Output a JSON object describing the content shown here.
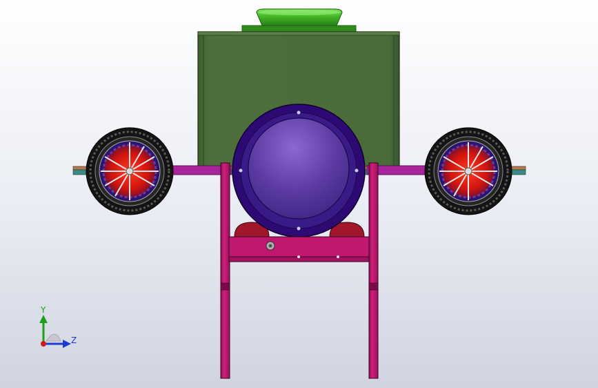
{
  "view": {
    "background_top": "#ffffff",
    "background_bottom": "#cfd4e0"
  },
  "model": {
    "hopper_color": "#4a6b3a",
    "hopper_lid_color": "#3fb324",
    "drum_ring_color": "#2d0a73",
    "drum_color": "#5a3aa0",
    "frame_color": "#c0176f",
    "axle_color": "#8a2aa0",
    "tire_color": "#1a1a1a",
    "wheel_hub_color": "#e01a14"
  },
  "triad": {
    "y_label": "Y",
    "z_label": "Z",
    "y_color": "#1aa01a",
    "z_color": "#1a3ad0",
    "x_color": "#d01a1a"
  }
}
